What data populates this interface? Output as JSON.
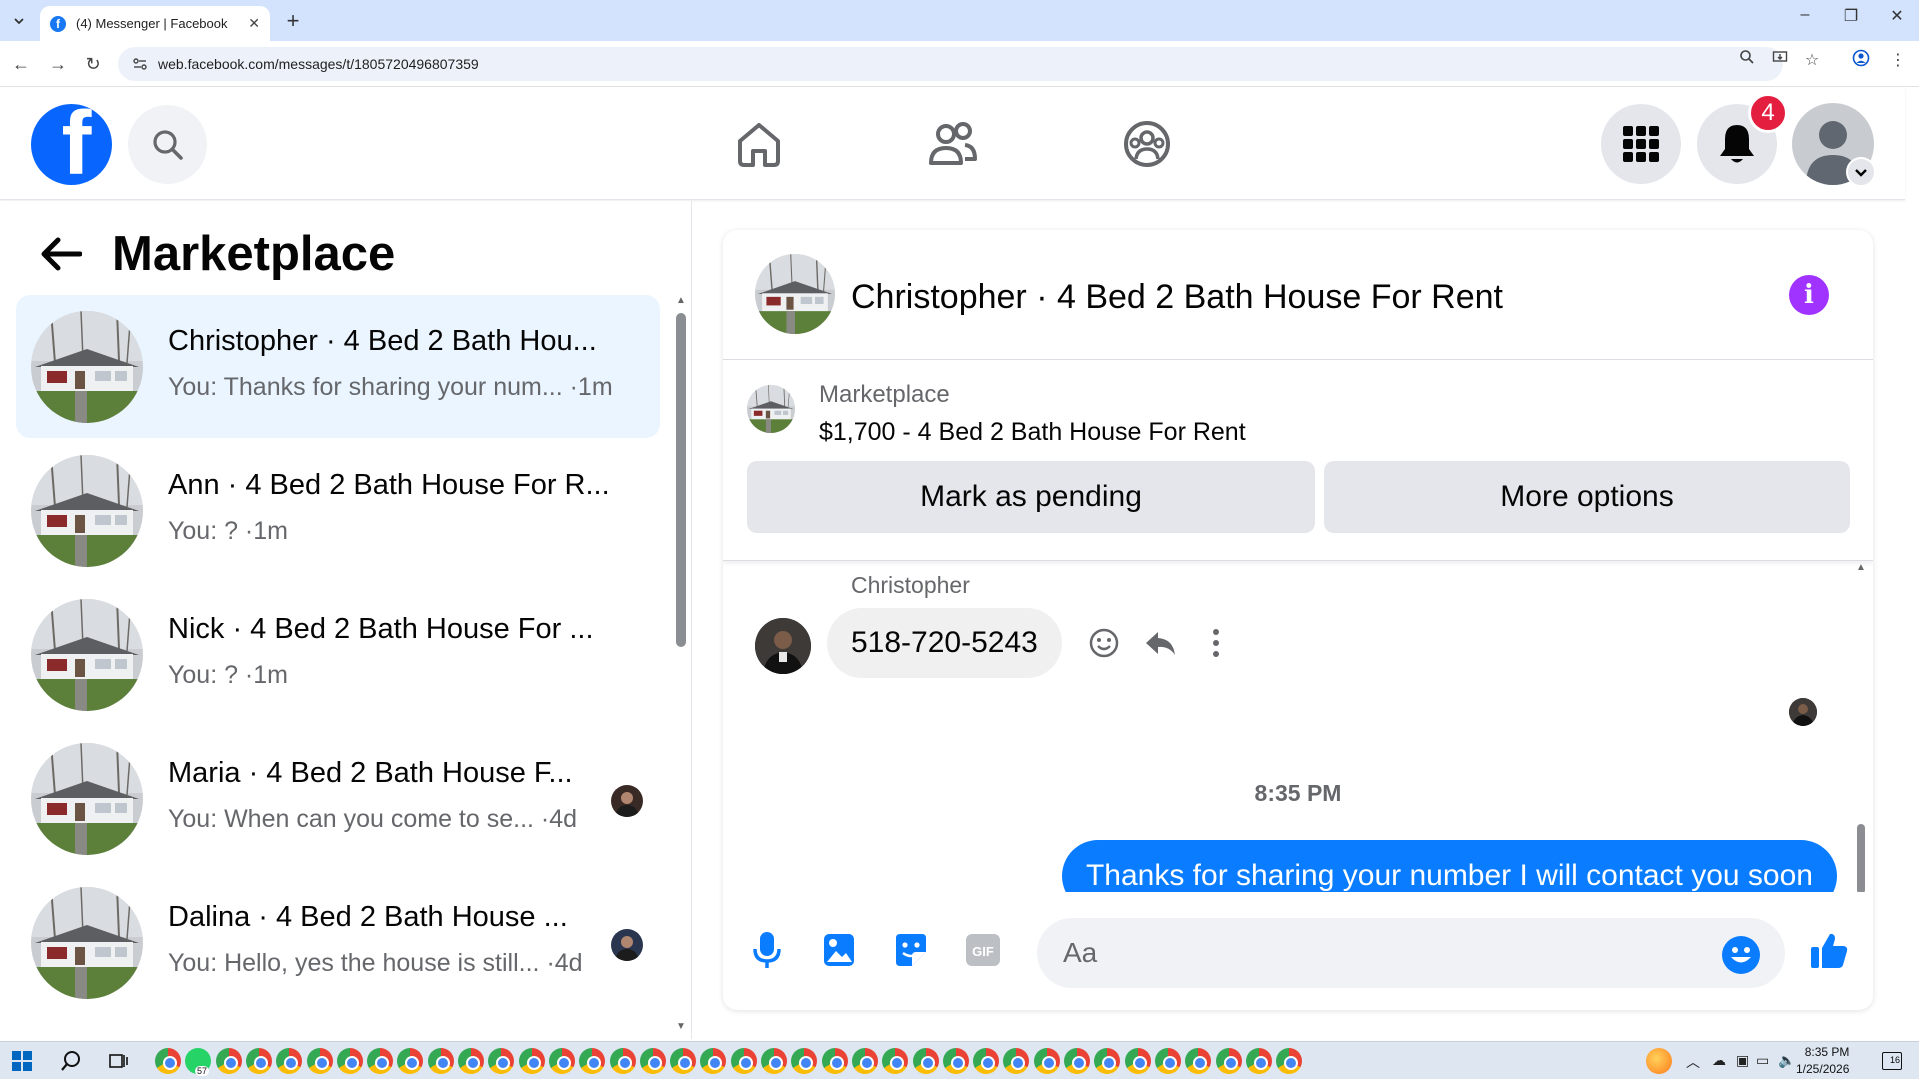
{
  "browser": {
    "tab_title": "(4) Messenger | Facebook",
    "tab_close": "✕",
    "new_tab": "+",
    "url": "web.facebook.com/messages/t/1805720496807359",
    "window_controls": [
      "–",
      "❐",
      "✕"
    ]
  },
  "header": {
    "logo_letter": "f",
    "notification_count": "4",
    "icons": [
      "search-icon",
      "home-icon",
      "friends-icon",
      "groups-icon",
      "menu-grid-icon",
      "bell-icon",
      "avatar"
    ]
  },
  "sidebar": {
    "title": "Marketplace",
    "conversations": [
      {
        "name": "Christopher · 4 Bed 2 Bath Hou...",
        "preview": "You: Thanks for sharing your num... ·1m",
        "active": true
      },
      {
        "name": "Ann · 4 Bed 2 Bath House For R...",
        "preview": "You: ? ·1m",
        "active": false
      },
      {
        "name": "Nick · 4 Bed 2 Bath House For ...",
        "preview": "You: ? ·1m",
        "active": false
      },
      {
        "name": "Maria · 4 Bed 2 Bath House F...",
        "preview": "You: When can you come to se... ·4d",
        "active": false
      },
      {
        "name": "Dalina · 4 Bed 2 Bath House ...",
        "preview": "You: Hello, yes the house is still... ·4d",
        "active": false
      }
    ]
  },
  "chat": {
    "title": "Christopher · 4 Bed 2 Bath House For Rent",
    "info_icon": "i",
    "marketplace_label": "Marketplace",
    "listing": "$1,700 - 4 Bed 2 Bath House For Rent",
    "mark_pending_label": "Mark as pending",
    "more_options_label": "More options",
    "sender_name": "Christopher",
    "incoming_message": "518-720-5243",
    "timestamp": "8:35 PM",
    "outgoing_message": "Thanks for sharing your number I will contact you soon",
    "composer_placeholder": "Aa",
    "gif_label": "GIF"
  },
  "taskbar": {
    "time": "8:35 PM",
    "date": "1/25/2026",
    "whatsapp_badge": "57",
    "notification_count": "16"
  },
  "colors": {
    "fb_blue": "#0866ff",
    "messenger_blue": "#0a7cff",
    "info_purple": "#a033ff",
    "badge_red": "#e41e3f"
  }
}
